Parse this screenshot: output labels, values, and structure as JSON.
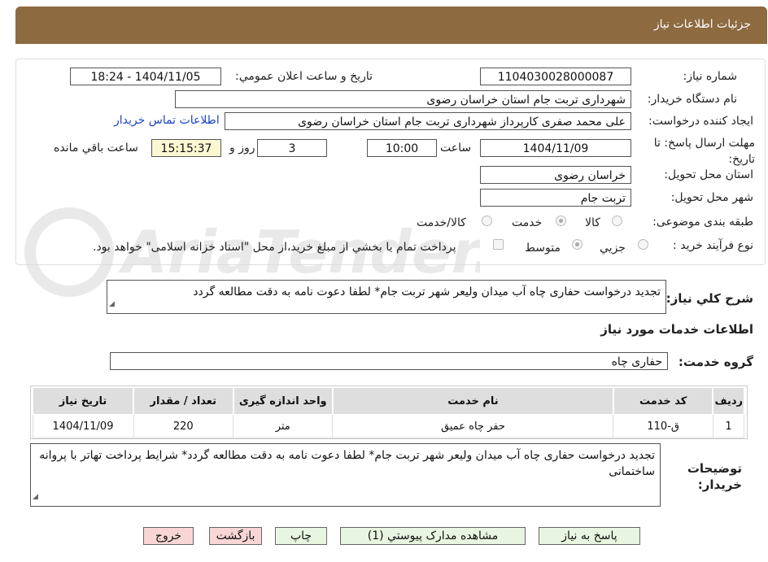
{
  "header": {
    "title": "جزئیات اطلاعات نیاز"
  },
  "fields": {
    "need_number_label": "شماره نیاز:",
    "need_number": "1104030028000087",
    "announce_label": "تاریخ و ساعت اعلان عمومي:",
    "announce_value": "1404/11/05 - 18:24",
    "buyer_org_label": "نام دستگاه خريدار:",
    "buyer_org": "شهرداری تربت جام استان خراسان رضوی",
    "requester_label": "ايجاد كننده درخواست:",
    "requester": "علی محمد صفری کارپرداز شهرداری تربت جام استان خراسان رضوی",
    "contact_link": "اطلاعات تماس خريدار",
    "deadline_label": "مهلت ارسال پاسخ: تا تاریخ:",
    "deadline_date": "1404/11/09",
    "time_label": "ساعت",
    "deadline_time": "10:00",
    "days_value": "3",
    "days_label": "روز و",
    "remaining_time": "15:15:37",
    "remaining_label": "ساعت باقي مانده",
    "province_label": "استان محل تحويل:",
    "province": "خراسان رضوی",
    "city_label": "شهر محل تحويل:",
    "city": "تربت جام",
    "category_label": "طبقه بندی موضوعی:",
    "category_options": [
      "كالا",
      "خدمت",
      "كالا/خدمت"
    ],
    "purchase_type_label": "نوع فرآیند خرید :",
    "purchase_options": [
      "جزيي",
      "متوسط"
    ],
    "payment_note": "پرداخت تمام يا بخشي از مبلغ خريد،از محل \"اسناد خزانه اسلامی\" خواهد بود.",
    "summary_label": "شرح كلي نياز:",
    "summary": "تجدید درخواست حفاری چاه آب میدان ولیعر شهر تربت جام* لطفا دعوت نامه به دقت مطالعه گردد"
  },
  "services": {
    "section_title": "اطلاعات خدمات مورد نياز",
    "group_label": "گروه خدمت:",
    "group_value": "حفاری چاه",
    "columns": [
      "رديف",
      "كد خدمت",
      "نام خدمت",
      "واحد اندازه گيری",
      "تعداد / مقدار",
      "تاريخ نياز"
    ],
    "rows": [
      {
        "index": "1",
        "code": "ق-110",
        "name": "حفر چاه عمیق",
        "unit": "متر",
        "qty": "220",
        "date": "1404/11/09"
      }
    ]
  },
  "buyer_notes": {
    "label": "توضيحات خريدار:",
    "text": "تجدید درخواست حفاری چاه آب میدان ولیعر شهر تربت جام* لطفا دعوت نامه به دقت مطالعه گردد* شرایط پرداخت تهاتر با پروانه ساختمانی"
  },
  "buttons": {
    "reply": "پاسخ به نياز",
    "attachments": "مشاهده مدارک پيوستي (1)",
    "print": "چاپ",
    "back": "بازگشت",
    "exit": "خروج"
  },
  "watermark": "AriaTender.neT",
  "colors": {
    "header": "#8d6a40",
    "link": "#1a44c8",
    "button_green": "#e8f5e0",
    "button_red": "#f9d6d6",
    "remaining_bg": "#fbf7d2"
  }
}
